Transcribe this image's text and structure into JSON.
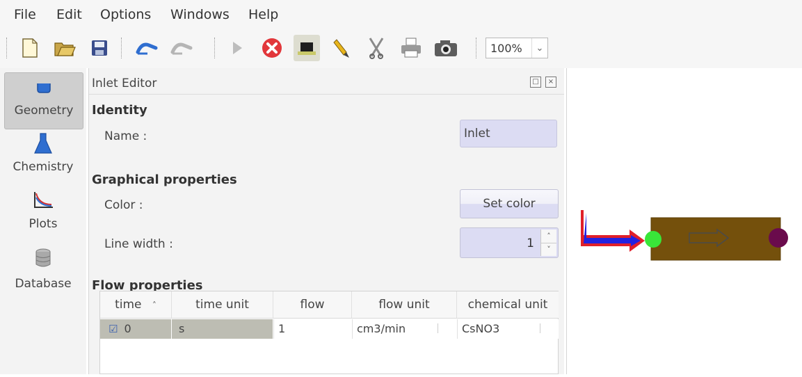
{
  "menu": {
    "file": "File",
    "edit": "Edit",
    "options": "Options",
    "windows": "Windows",
    "help": "Help"
  },
  "toolbar": {
    "icons": [
      "new-file-icon",
      "open-folder-icon",
      "save-disk-icon",
      "link-icon",
      "unlink-icon",
      "play-icon",
      "stop-icon",
      "monitor-icon",
      "pen-icon",
      "cut-icon",
      "print-icon",
      "camera-icon"
    ],
    "zoom": "100%"
  },
  "sidebar": {
    "items": [
      {
        "label": "Geometry",
        "icon": "beaker-icon",
        "active": true
      },
      {
        "label": "Chemistry",
        "icon": "flask-icon"
      },
      {
        "label": "Plots",
        "icon": "plot-icon"
      },
      {
        "label": "Database",
        "icon": "database-icon"
      }
    ]
  },
  "editor": {
    "title": "Inlet Editor",
    "identity": {
      "heading": "Identity",
      "name_label": "Name :",
      "name_value": "Inlet"
    },
    "graphical": {
      "heading": "Graphical properties",
      "color_label": "Color :",
      "set_color": "Set color",
      "line_width_label": "Line width :",
      "line_width_value": "1"
    },
    "flow": {
      "heading": "Flow properties",
      "columns": [
        "time",
        "time unit",
        "flow",
        "flow unit",
        "chemical unit"
      ],
      "row": {
        "time": "0",
        "time_unit": "s",
        "flow": "1",
        "flow_unit": "cm3/min",
        "chemical_unit": "CsNO3"
      }
    }
  },
  "colors": {
    "accent_input": "#dcdcf3",
    "pipe_body": "#74500c",
    "inlet_node": "#39e639",
    "outlet_node": "#6a0b4c",
    "inlet_arrow": "#2222e0",
    "arrow_border": "#e0202a"
  }
}
